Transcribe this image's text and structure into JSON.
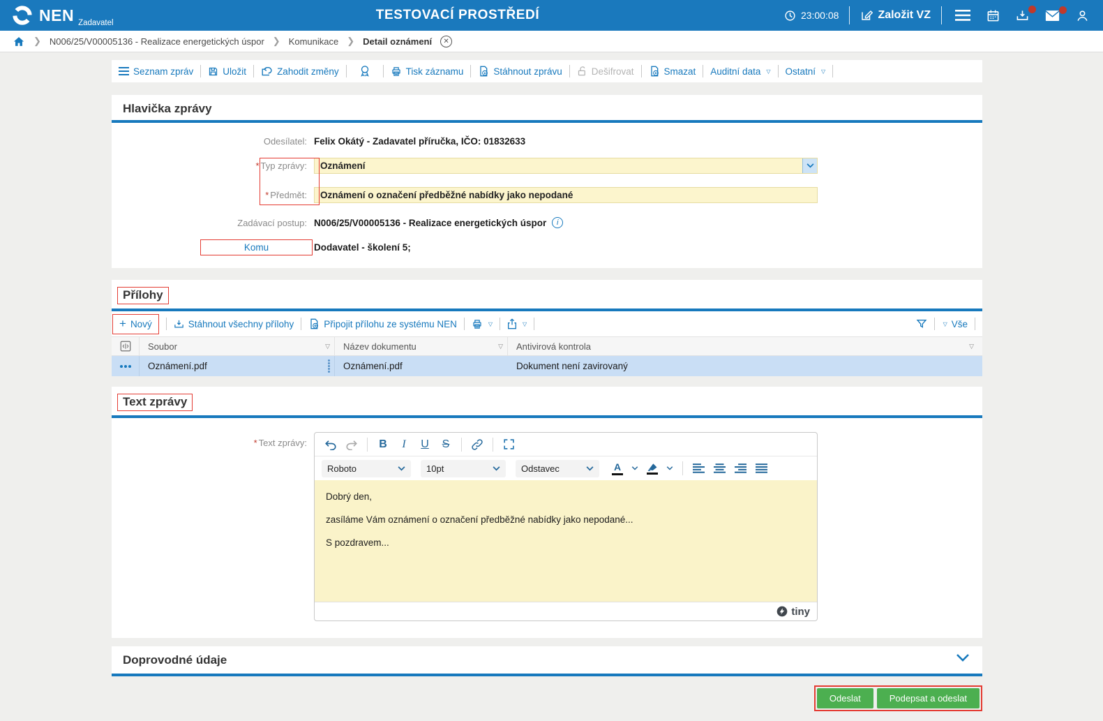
{
  "app": {
    "brand": "NEN",
    "brand_sub": "Zadavatel",
    "environment": "TESTOVACÍ PROSTŘEDÍ",
    "time": "23:00:08",
    "new_vz_label": "Založit VZ"
  },
  "breadcrumb": {
    "items": [
      {
        "label": "N006/25/V00005136 - Realizace energetických úspor"
      },
      {
        "label": "Komunikace"
      },
      {
        "label": "Detail oznámení"
      }
    ]
  },
  "toolbar": {
    "seznam_zprav": "Seznam zpráv",
    "ulozit": "Uložit",
    "zahodit_zmeny": "Zahodit změny",
    "tisk_zaznamu": "Tisk záznamu",
    "stahnout_zpravu": "Stáhnout zprávu",
    "desifrovat": "Dešifrovat",
    "smazat": "Smazat",
    "auditni_data": "Auditní data",
    "ostatni": "Ostatní"
  },
  "message_header": {
    "title": "Hlavička zprávy",
    "required_mark": "*",
    "sender_label": "Odesílatel:",
    "sender_value": "Felix Okátý - Zadavatel příručka, IČO: 01832633",
    "type_label": "Typ zprávy:",
    "type_value": "Oznámení",
    "subject_label": "Předmět:",
    "subject_value": "Oznámení o označení předběžné nabídky jako nepodané",
    "procedure_label": "Zadávací postup:",
    "procedure_value": "N006/25/V00005136 - Realizace energetických úspor",
    "to_label": "Komu",
    "to_value": "Dodavatel - školení 5;"
  },
  "attachments": {
    "title": "Přílohy",
    "new_label": "Nový",
    "download_all_label": "Stáhnout všechny přílohy",
    "attach_from_nen_label": "Připojit přílohu ze systému NEN",
    "all_filter_label": "Vše",
    "columns": [
      {
        "label": "Soubor"
      },
      {
        "label": "Název dokumentu"
      },
      {
        "label": "Antivirová kontrola"
      }
    ],
    "rows": [
      {
        "file": "Oznámení.pdf",
        "doc_name": "Oznámení.pdf",
        "antivirus": "Dokument není zavirovaný"
      }
    ]
  },
  "message_body": {
    "title": "Text zprávy",
    "field_label": "Text zprávy:",
    "editor": {
      "font_name": "Roboto",
      "font_size": "10pt",
      "block_format": "Odstavec",
      "lines": [
        {
          "text": "Dobrý den,"
        },
        {
          "text": "zasíláme Vám oznámení o označení předběžné nabídky jako nepodané..."
        },
        {
          "text": "S pozdravem..."
        }
      ],
      "brand": "tiny"
    }
  },
  "accompanying": {
    "title": "Doprovodné údaje"
  },
  "actions": {
    "send_label": "Odeslat",
    "sign_and_send_label": "Podepsat a odeslat"
  },
  "colors": {
    "header_blue": "#1a79bd",
    "accent_blue": "#1779bd",
    "field_yellow": "#fcf5cd",
    "editor_yellow": "#faf3c9",
    "selected_row_blue": "#c9def5",
    "button_green": "#4caf50",
    "annotation_red": "#e43b32"
  }
}
